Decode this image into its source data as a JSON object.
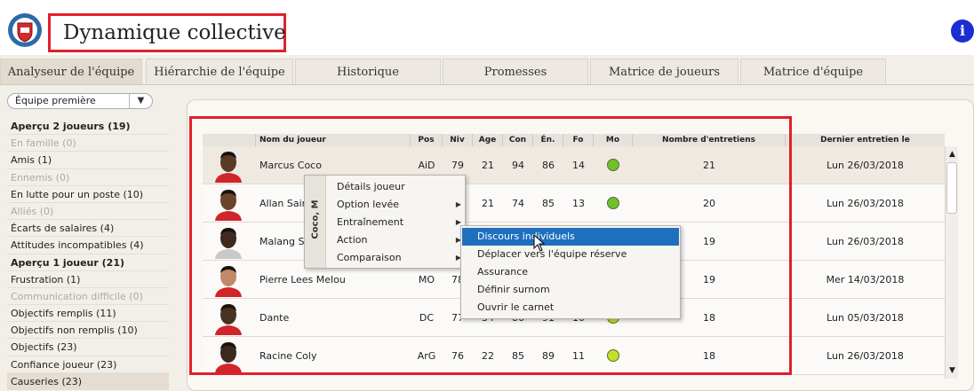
{
  "header": {
    "title": "Dynamique collective",
    "info_glyph": "i"
  },
  "tabs": [
    {
      "label": "Analyseur de l'équipe",
      "active": true
    },
    {
      "label": "Hiérarchie de l'équipe"
    },
    {
      "label": "Historique"
    },
    {
      "label": "Promesses"
    },
    {
      "label": "Matrice de joueurs"
    },
    {
      "label": "Matrice d'équipe"
    }
  ],
  "sidebar": {
    "dropdown_value": "Équipe première",
    "items": [
      {
        "label": "Aperçu 2 joueurs (19)",
        "style": "bold"
      },
      {
        "label": "En famille (0)",
        "style": "disabled"
      },
      {
        "label": "Amis (1)"
      },
      {
        "label": "Ennemis (0)",
        "style": "disabled"
      },
      {
        "label": "En lutte pour un poste (10)"
      },
      {
        "label": "Alliés (0)",
        "style": "disabled"
      },
      {
        "label": "Écarts de salaires (4)"
      },
      {
        "label": "Attitudes incompatibles (4)"
      },
      {
        "label": "Aperçu 1 joueur (21)",
        "style": "bold"
      },
      {
        "label": "Frustration (1)"
      },
      {
        "label": "Communication difficile (0)",
        "style": "disabled"
      },
      {
        "label": "Objectifs remplis (11)"
      },
      {
        "label": "Objectifs non remplis (10)"
      },
      {
        "label": "Objectifs (23)"
      },
      {
        "label": "Confiance joueur (23)"
      },
      {
        "label": "Causeries (23)",
        "style": "selected"
      }
    ]
  },
  "table": {
    "columns": {
      "name": "Nom du joueur",
      "pos": "Pos",
      "niv": "Niv",
      "age": "Age",
      "con": "Con",
      "en": "Én.",
      "fo": "Fo",
      "mo": "Mo",
      "talks": "Nombre d'entretiens",
      "last": "Dernier entretien le"
    },
    "rows": [
      {
        "name": "Marcus Coco",
        "pos": "AiD",
        "niv": "79",
        "age": "21",
        "con": "94",
        "en": "86",
        "fo": "14",
        "morale_color": "#6fc02e",
        "talks": "21",
        "last": "Lun 26/03/2018"
      },
      {
        "name": "Allan Saint-Maximin",
        "pos": "",
        "niv": "",
        "age": "21",
        "con": "74",
        "en": "85",
        "fo": "13",
        "morale_color": "#6fc02e",
        "talks": "20",
        "last": "Lun 26/03/2018"
      },
      {
        "name": "Malang Sarr",
        "pos": "",
        "niv": "",
        "age": "",
        "con": "",
        "en": "",
        "fo": "",
        "morale_color": "",
        "talks": "19",
        "last": "Lun 26/03/2018"
      },
      {
        "name": "Pierre Lees Melou",
        "pos": "MO",
        "niv": "78",
        "age": "",
        "con": "",
        "en": "",
        "fo": "",
        "morale_color": "",
        "talks": "19",
        "last": "Mer 14/03/2018"
      },
      {
        "name": "Dante",
        "pos": "DC",
        "niv": "77",
        "age": "34",
        "con": "86",
        "en": "91",
        "fo": "10",
        "morale_color": "#c4e02a",
        "talks": "18",
        "last": "Lun 05/03/2018"
      },
      {
        "name": "Racine Coly",
        "pos": "ArG",
        "niv": "76",
        "age": "22",
        "con": "85",
        "en": "89",
        "fo": "11",
        "morale_color": "#c4e02a",
        "talks": "18",
        "last": "Lun 26/03/2018"
      }
    ]
  },
  "context_menu": {
    "side_label": "Coco, M",
    "items": [
      {
        "label": "Détails joueur",
        "submenu": false
      },
      {
        "label": "Option levée",
        "submenu": true
      },
      {
        "label": "Entraînement",
        "submenu": true
      },
      {
        "label": "Action",
        "submenu": true
      },
      {
        "label": "Comparaison",
        "submenu": true
      }
    ]
  },
  "submenu": {
    "items": [
      {
        "label": "Discours individuels",
        "highlighted": true
      },
      {
        "label": "Déplacer vers l'équipe réserve"
      },
      {
        "label": "Assurance"
      },
      {
        "label": "Définir surnom"
      },
      {
        "label": "Ouvrir le carnet"
      }
    ]
  },
  "icons": {
    "logo": "club-crest-icon",
    "info": "info-icon",
    "dropdown": "chevron-down-icon",
    "submenu_arrow": "triangle-right-icon",
    "scroll_up": "triangle-up-icon",
    "scroll_down": "triangle-down-icon",
    "cursor": "mouse-pointer-icon"
  },
  "colors": {
    "highlight_frame": "#e0202a",
    "menu_highlight": "#1f6fbf",
    "info_button": "#1a2fd0"
  }
}
